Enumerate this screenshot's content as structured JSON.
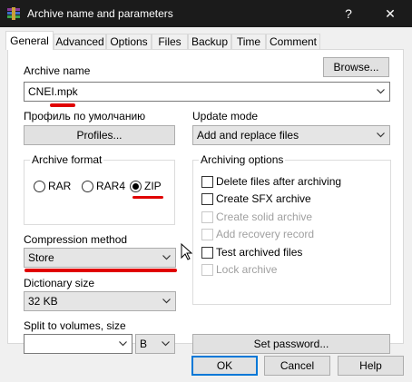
{
  "window": {
    "title": "Archive name and parameters",
    "help_glyph": "?",
    "close_glyph": "✕"
  },
  "tabs": [
    "General",
    "Advanced",
    "Options",
    "Files",
    "Backup",
    "Time",
    "Comment"
  ],
  "archive_name": {
    "label": "Archive name",
    "value": "CNEI.mpk",
    "browse_label": "Browse..."
  },
  "profile": {
    "label": "Профиль по умолчанию",
    "button_label": "Profiles..."
  },
  "update_mode": {
    "label": "Update mode",
    "value": "Add and replace files"
  },
  "archive_format": {
    "label": "Archive format",
    "options": [
      "RAR",
      "RAR4",
      "ZIP"
    ],
    "selected": "ZIP"
  },
  "compression": {
    "label": "Compression method",
    "value": "Store"
  },
  "dictionary": {
    "label": "Dictionary size",
    "value": "32 KB"
  },
  "split": {
    "label": "Split to volumes, size",
    "value": "",
    "unit": "B"
  },
  "archiving_options": {
    "label": "Archiving options",
    "items": [
      {
        "label": "Delete files after archiving",
        "enabled": true,
        "checked": false
      },
      {
        "label": "Create SFX archive",
        "enabled": true,
        "checked": false
      },
      {
        "label": "Create solid archive",
        "enabled": false,
        "checked": false
      },
      {
        "label": "Add recovery record",
        "enabled": false,
        "checked": false
      },
      {
        "label": "Test archived files",
        "enabled": true,
        "checked": false
      },
      {
        "label": "Lock archive",
        "enabled": false,
        "checked": false
      }
    ]
  },
  "set_password_label": "Set password...",
  "footer": {
    "ok": "OK",
    "cancel": "Cancel",
    "help": "Help"
  },
  "colors": {
    "titlebar": "#1b1b1b",
    "annotation": "#e00000",
    "default_button_border": "#0078d7"
  }
}
